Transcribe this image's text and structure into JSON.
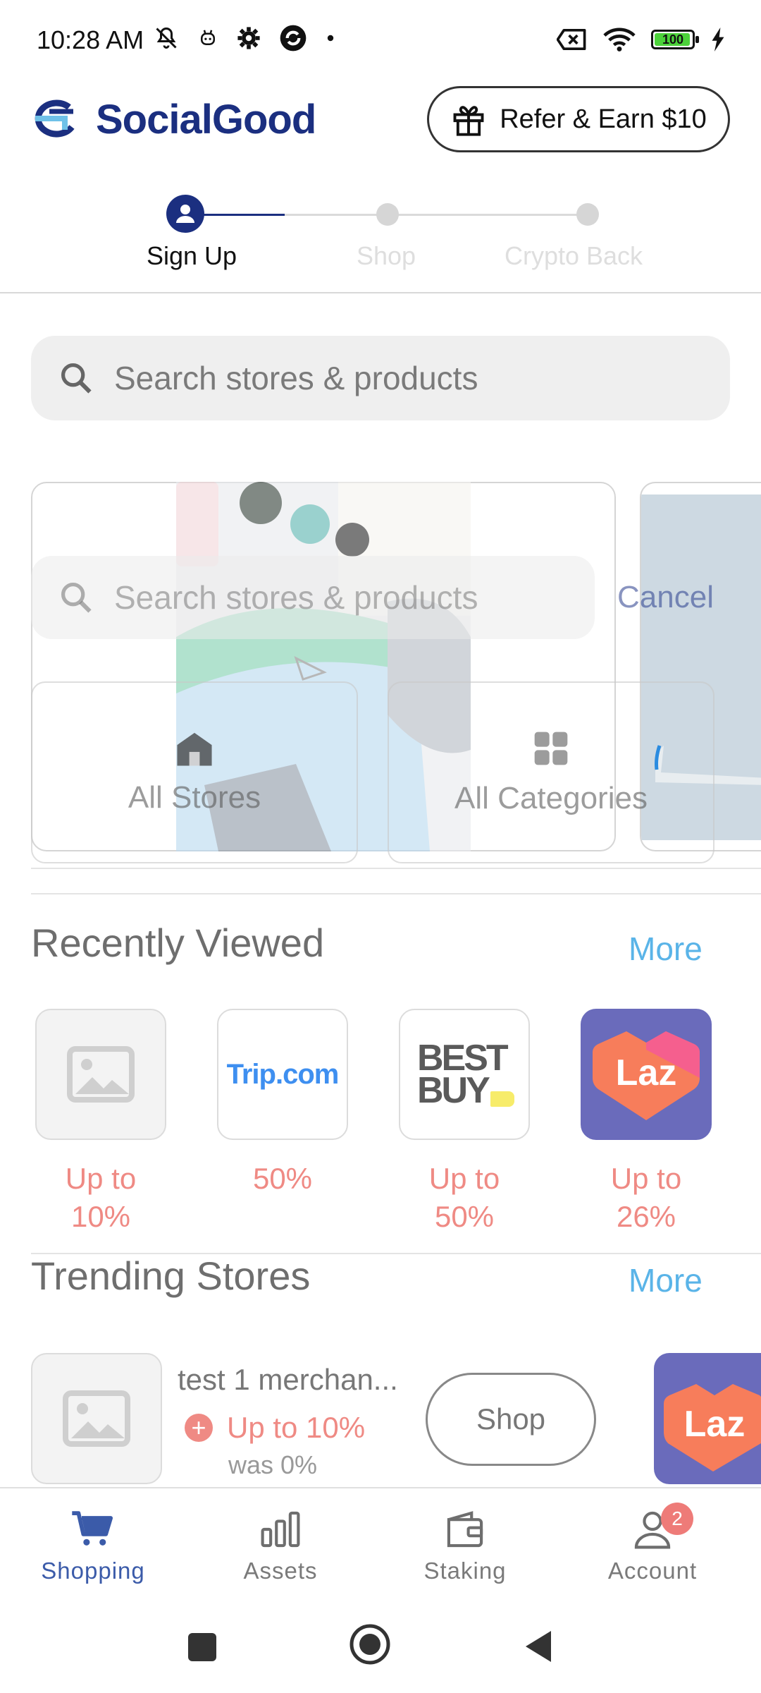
{
  "status_bar": {
    "time": "10:28 AM",
    "battery": "100",
    "icons_left": [
      "mute-icon",
      "bot-icon",
      "gear-icon",
      "app-icon",
      "dot-icon"
    ],
    "icons_right": [
      "screen-x-icon",
      "wifi-icon",
      "battery-icon",
      "charging-icon"
    ]
  },
  "header": {
    "logo_text": "SocialGood",
    "refer_label": "Refer & Earn $10",
    "refer_icon": "gift-icon",
    "brand_color": "#1b2f80"
  },
  "stepper": {
    "steps": [
      {
        "label": "Sign Up",
        "active": true
      },
      {
        "label": "Shop",
        "active": false
      },
      {
        "label": "Crypto Back",
        "active": false
      }
    ],
    "active_color": "#1b2f80"
  },
  "search": {
    "placeholder": "Search stores & products"
  },
  "overlay": {
    "search_placeholder": "Search stores & products",
    "cancel_label": "Cancel",
    "categories": [
      {
        "label": "All Stores",
        "icon": "store-icon"
      },
      {
        "label": "All Categories",
        "icon": "grid-icon"
      }
    ]
  },
  "recently_viewed": {
    "title": "Recently Viewed",
    "more_label": "More",
    "items": [
      {
        "logo": "placeholder-image-icon",
        "cashback": "Up to 10%"
      },
      {
        "logo": "Trip.com",
        "cashback": "50%"
      },
      {
        "logo": "BEST BUY",
        "cashback": "Up to 50%"
      },
      {
        "logo": "Laz",
        "cashback": "Up to 26%"
      }
    ]
  },
  "trending_stores": {
    "title": "Trending Stores",
    "more_label": "More",
    "items": [
      {
        "name": "test 1 merchan...",
        "offer": "Up to 10%",
        "was": "was 0%",
        "shop_label": "Shop"
      }
    ],
    "next_logo": "Laz"
  },
  "bottom_nav": {
    "items": [
      {
        "label": "Shopping",
        "icon": "cart-icon",
        "active": true
      },
      {
        "label": "Assets",
        "icon": "bar-chart-icon",
        "active": false
      },
      {
        "label": "Staking",
        "icon": "wallet-icon",
        "active": false
      },
      {
        "label": "Account",
        "icon": "person-icon",
        "active": false,
        "badge": "2"
      }
    ]
  },
  "colors": {
    "cashback": "#ef8a84",
    "more_link": "#5ab4e8",
    "nav_active": "#3b5ba9"
  }
}
